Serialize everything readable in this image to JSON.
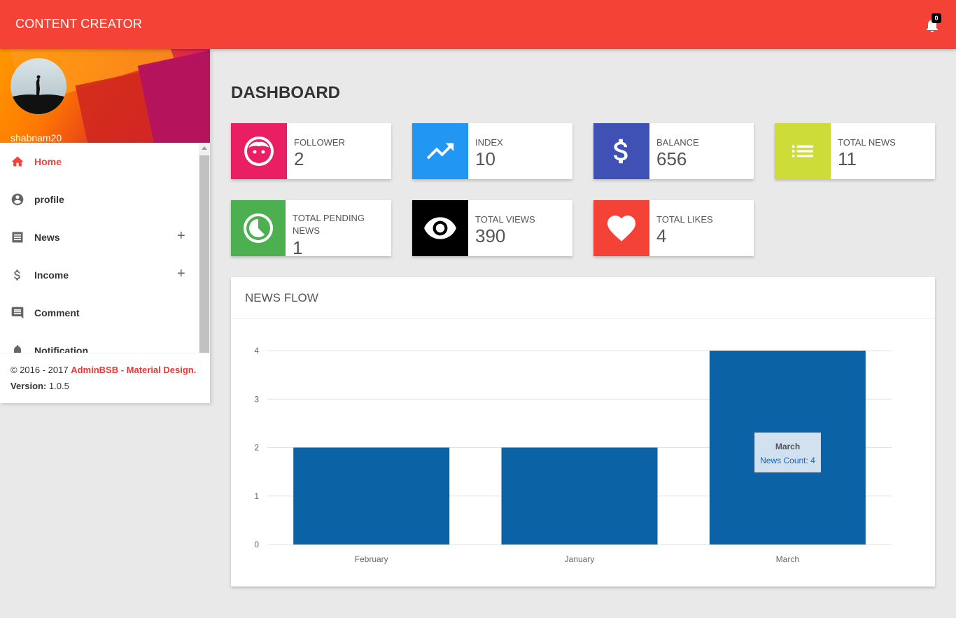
{
  "header": {
    "brand": "CONTENT CREATOR",
    "notification_count": "0"
  },
  "sidebar": {
    "username": "shabnam20",
    "items": [
      {
        "label": "Home",
        "icon": "home-icon",
        "active": true
      },
      {
        "label": "profile",
        "icon": "account-circle-icon"
      },
      {
        "label": "News",
        "icon": "list-icon",
        "expand": "+"
      },
      {
        "label": "Income",
        "icon": "dollar-icon",
        "expand": "+"
      },
      {
        "label": "Comment",
        "icon": "comment-icon"
      },
      {
        "label": "Notification",
        "icon": "bell-icon"
      }
    ],
    "legal": {
      "copyright_prefix": "© 2016 - 2017 ",
      "copyright_link": "AdminBSB - Material Design.",
      "version_label": "Version:",
      "version_value": " 1.0.5"
    }
  },
  "main": {
    "title": "DASHBOARD",
    "info_boxes": [
      {
        "label": "FOLLOWER",
        "value": "2",
        "color": "#e91e63",
        "icon": "face-icon"
      },
      {
        "label": "INDEX",
        "value": "10",
        "color": "#2196f3",
        "icon": "trending-up-icon"
      },
      {
        "label": "BALANCE",
        "value": "656",
        "color": "#3f51b5",
        "icon": "dollar-icon"
      },
      {
        "label": "TOTAL NEWS",
        "value": "11",
        "color": "#cddc39",
        "icon": "list-icon"
      },
      {
        "label": "TOTAL PENDING NEWS",
        "value": "1",
        "color": "#4caf50",
        "icon": "timelapse-icon"
      },
      {
        "label": "TOTAL VIEWS",
        "value": "390",
        "color": "#000000",
        "icon": "eye-icon"
      },
      {
        "label": "TOTAL LIKES",
        "value": "4",
        "color": "#f44336",
        "icon": "heart-icon"
      }
    ],
    "chart_card": {
      "title": "NEWS FLOW"
    }
  },
  "chart_data": {
    "type": "bar",
    "categories": [
      "February",
      "January",
      "March"
    ],
    "series": [
      {
        "name": "News Count",
        "values": [
          2,
          2,
          4
        ],
        "color": "#0b62a4"
      }
    ],
    "ylim": [
      0,
      4
    ],
    "yticks": [
      0,
      1,
      2,
      3,
      4
    ],
    "grid": true,
    "tooltip": {
      "title": "March",
      "text": "News Count: 4"
    }
  }
}
